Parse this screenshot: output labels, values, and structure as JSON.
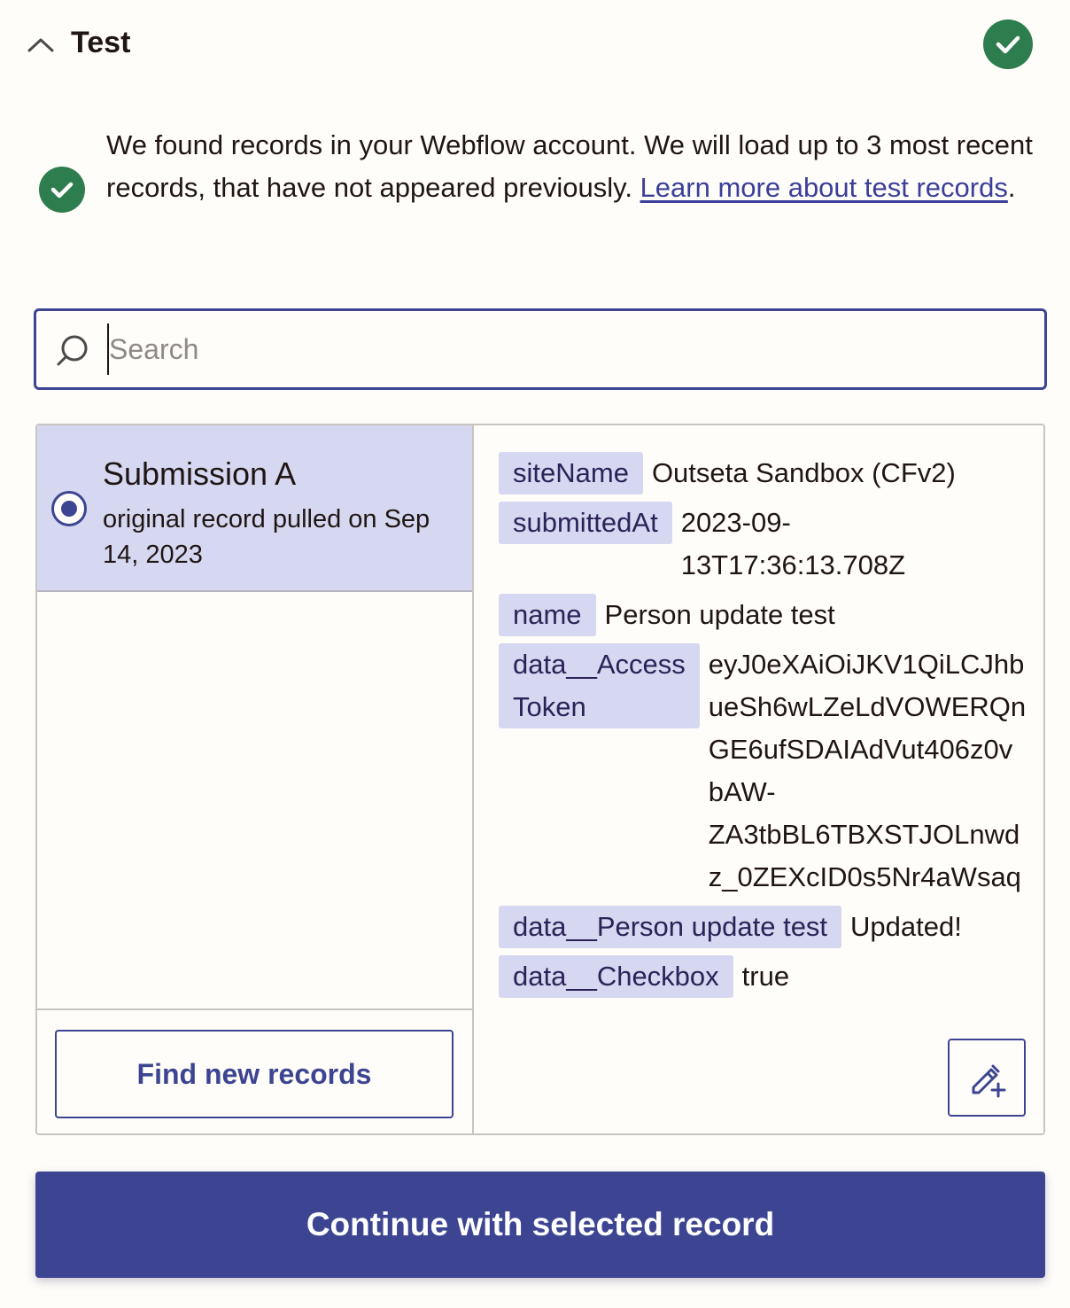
{
  "section": {
    "title": "Test",
    "status": "success"
  },
  "info": {
    "text": "We found records in your Webflow account. We will load up to 3 most recent records, that have not appeared previously. ",
    "link_text": "Learn more about test records",
    "trailing": "."
  },
  "search": {
    "placeholder": "Search",
    "value": ""
  },
  "records": [
    {
      "title": "Submission A",
      "subtitle": "original record pulled on Sep 14, 2023",
      "selected": true
    }
  ],
  "record_fields": [
    {
      "key": "siteName",
      "value": "Outseta Sandbox (CFv2)"
    },
    {
      "key": "submittedAt",
      "value": "2023-09-\n13T17:36:13.708Z"
    },
    {
      "key": "name",
      "value": "Person update test"
    },
    {
      "key": "data__Access\nToken",
      "value": "eyJ0eXAiOiJKV1QiLCJhb\nueSh6wLZeLdVOWERQn\nGE6ufSDAIAdVut406z0v\nbAW-\nZA3tbBL6TBXSTJOLnwd\nz_0ZEXcID0s5Nr4aWsaq"
    },
    {
      "key": "data__Person update test",
      "value": "Updated!"
    },
    {
      "key": "data__Checkbox",
      "value": "true"
    }
  ],
  "buttons": {
    "find_new": "Find new records",
    "continue": "Continue with selected record"
  },
  "icons": {
    "collapse": "chevron-up-icon",
    "status": "check-circle-icon",
    "search": "search-icon",
    "edit": "edit-add-icon"
  },
  "colors": {
    "accent": "#3d4592",
    "success": "#2e7d4f",
    "selected_bg": "#d5d8f0",
    "background": "#fffdf9"
  }
}
